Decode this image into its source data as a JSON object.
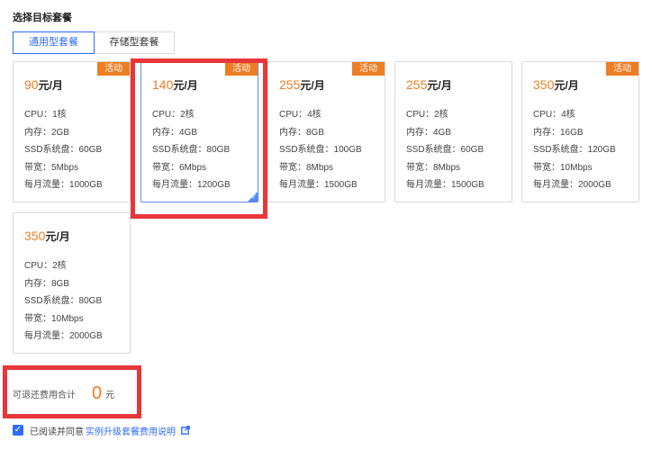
{
  "section": {
    "title": "选择目标套餐"
  },
  "tabs": [
    {
      "label": "通用型套餐",
      "active": true
    },
    {
      "label": "存储型套餐",
      "active": false
    }
  ],
  "plans": [
    {
      "price": "90",
      "unit": "元/月",
      "badge": "活动",
      "selected": false,
      "specs": [
        "CPU：1核",
        "内存：2GB",
        "SSD系统盘：60GB",
        "带宽：5Mbps",
        "每月流量：1000GB"
      ]
    },
    {
      "price": "140",
      "unit": "元/月",
      "badge": "活动",
      "selected": true,
      "specs": [
        "CPU：2核",
        "内存：4GB",
        "SSD系统盘：80GB",
        "带宽：6Mbps",
        "每月流量：1200GB"
      ]
    },
    {
      "price": "255",
      "unit": "元/月",
      "badge": "活动",
      "selected": false,
      "specs": [
        "CPU：4核",
        "内存：8GB",
        "SSD系统盘：100GB",
        "带宽：8Mbps",
        "每月流量：1500GB"
      ]
    },
    {
      "price": "255",
      "unit": "元/月",
      "badge": "",
      "selected": false,
      "specs": [
        "CPU：2核",
        "内存：4GB",
        "SSD系统盘：60GB",
        "带宽：8Mbps",
        "每月流量：1500GB"
      ]
    },
    {
      "price": "350",
      "unit": "元/月",
      "badge": "活动",
      "selected": false,
      "specs": [
        "CPU：4核",
        "内存：16GB",
        "SSD系统盘：120GB",
        "带宽：10Mbps",
        "每月流量：2000GB"
      ]
    },
    {
      "price": "350",
      "unit": "元/月",
      "badge": "",
      "selected": false,
      "specs": [
        "CPU：2核",
        "内存：8GB",
        "SSD系统盘：80GB",
        "带宽：10Mbps",
        "每月流量：2000GB"
      ]
    }
  ],
  "refund": {
    "label": "可退还费用合计",
    "amount": "0",
    "unit": "元"
  },
  "agreement": {
    "checked": true,
    "text": "已阅读并同意",
    "link": "实例升级套餐费用说明"
  },
  "colors": {
    "accent": "#2f6bff",
    "price": "#ef7d23",
    "badge": "#ef7d23",
    "highlight": "#e8363a"
  },
  "icons": {
    "checkbox": "check-icon",
    "link": "external-link-icon",
    "selected_corner": "check-icon"
  }
}
